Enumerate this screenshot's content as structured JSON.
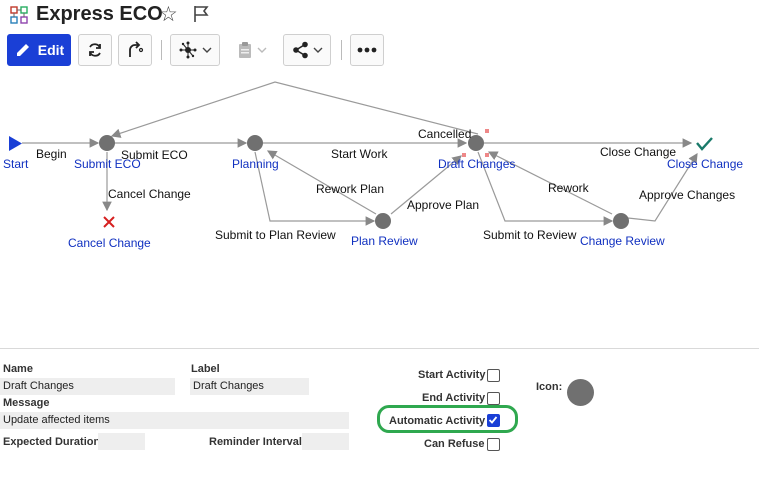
{
  "header": {
    "title": "Express ECO",
    "icons": [
      "workflow-icon",
      "star-icon",
      "flag-icon"
    ]
  },
  "toolbar": {
    "edit_label": "Edit",
    "icons": [
      "pencil-icon",
      "refresh-icon",
      "route-icon",
      "hub-icon",
      "chevron-down-icon",
      "clipboard-icon",
      "share-icon",
      "more-icon"
    ]
  },
  "diagram": {
    "nodes": {
      "start": "Start",
      "submit_eco": "Submit ECO",
      "cancel_change": "Cancel Change",
      "planning": "Planning",
      "plan_review": "Plan Review",
      "draft_changes": "Draft Changes",
      "change_review": "Change Review",
      "close_change": "Close Change"
    },
    "edges": {
      "begin": "Begin",
      "submit_eco": "Submit ECO",
      "cancel_change": "Cancel Change",
      "start_work": "Start Work",
      "rework_plan": "Rework Plan",
      "submit_plan_review": "Submit to Plan Review",
      "approve_plan": "Approve Plan",
      "cancelled": "Cancelled",
      "close_change": "Close Change",
      "rework": "Rework",
      "submit_review": "Submit to Review",
      "approve_changes": "Approve Changes"
    },
    "colors": {
      "node": "#707070",
      "link": "#1030c0",
      "start": "#1a3fd6",
      "cancel": "#d62020",
      "done": "#1a7a6a"
    }
  },
  "properties": {
    "name_label": "Name",
    "name_value": "Draft Changes",
    "label_label": "Label",
    "label_value": "Draft Changes",
    "message_label": "Message",
    "message_value": "Update affected items",
    "expected_duration_label": "Expected Duration",
    "expected_duration_value": "",
    "reminder_interval_label": "Reminder Interval",
    "reminder_interval_value": "",
    "start_activity_label": "Start Activity",
    "start_activity_checked": false,
    "end_activity_label": "End Activity",
    "end_activity_checked": false,
    "automatic_activity_label": "Automatic Activity",
    "automatic_activity_checked": true,
    "can_refuse_label": "Can Refuse",
    "can_refuse_checked": false,
    "icon_label": "Icon:"
  }
}
